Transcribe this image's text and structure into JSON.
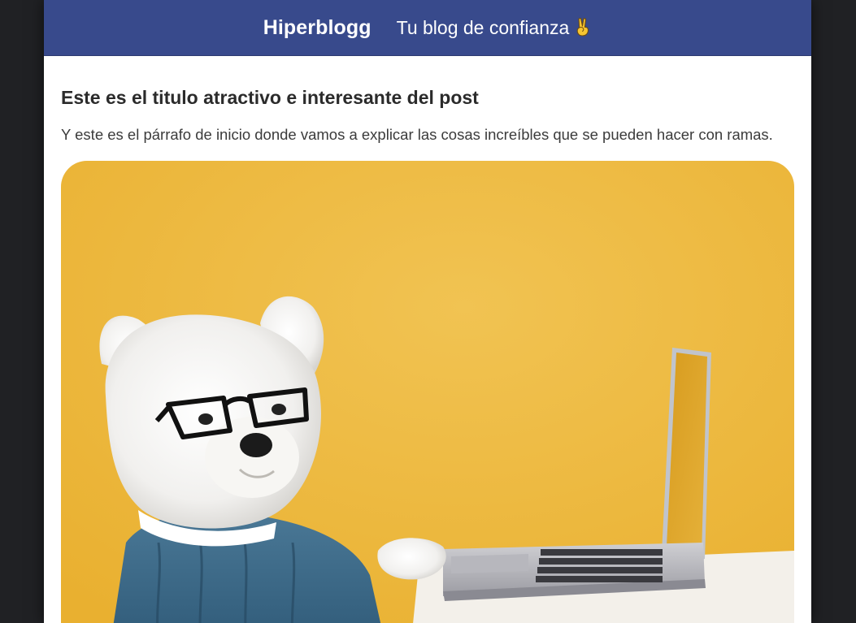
{
  "header": {
    "site_name": "Hiperblogg",
    "tagline": "Tu blog de confianza",
    "tagline_emoji": "victory-hand-icon",
    "background_color": "#384a8c"
  },
  "post": {
    "title": "Este es el titulo atractivo e interesante del post",
    "intro": "Y este es el párrafo de inicio donde vamos a explicar las cosas increíbles que se pueden hacer con ramas.",
    "image": {
      "subject": "dog-with-glasses-and-laptop-photo",
      "background_color": "#f0bd3c"
    }
  }
}
